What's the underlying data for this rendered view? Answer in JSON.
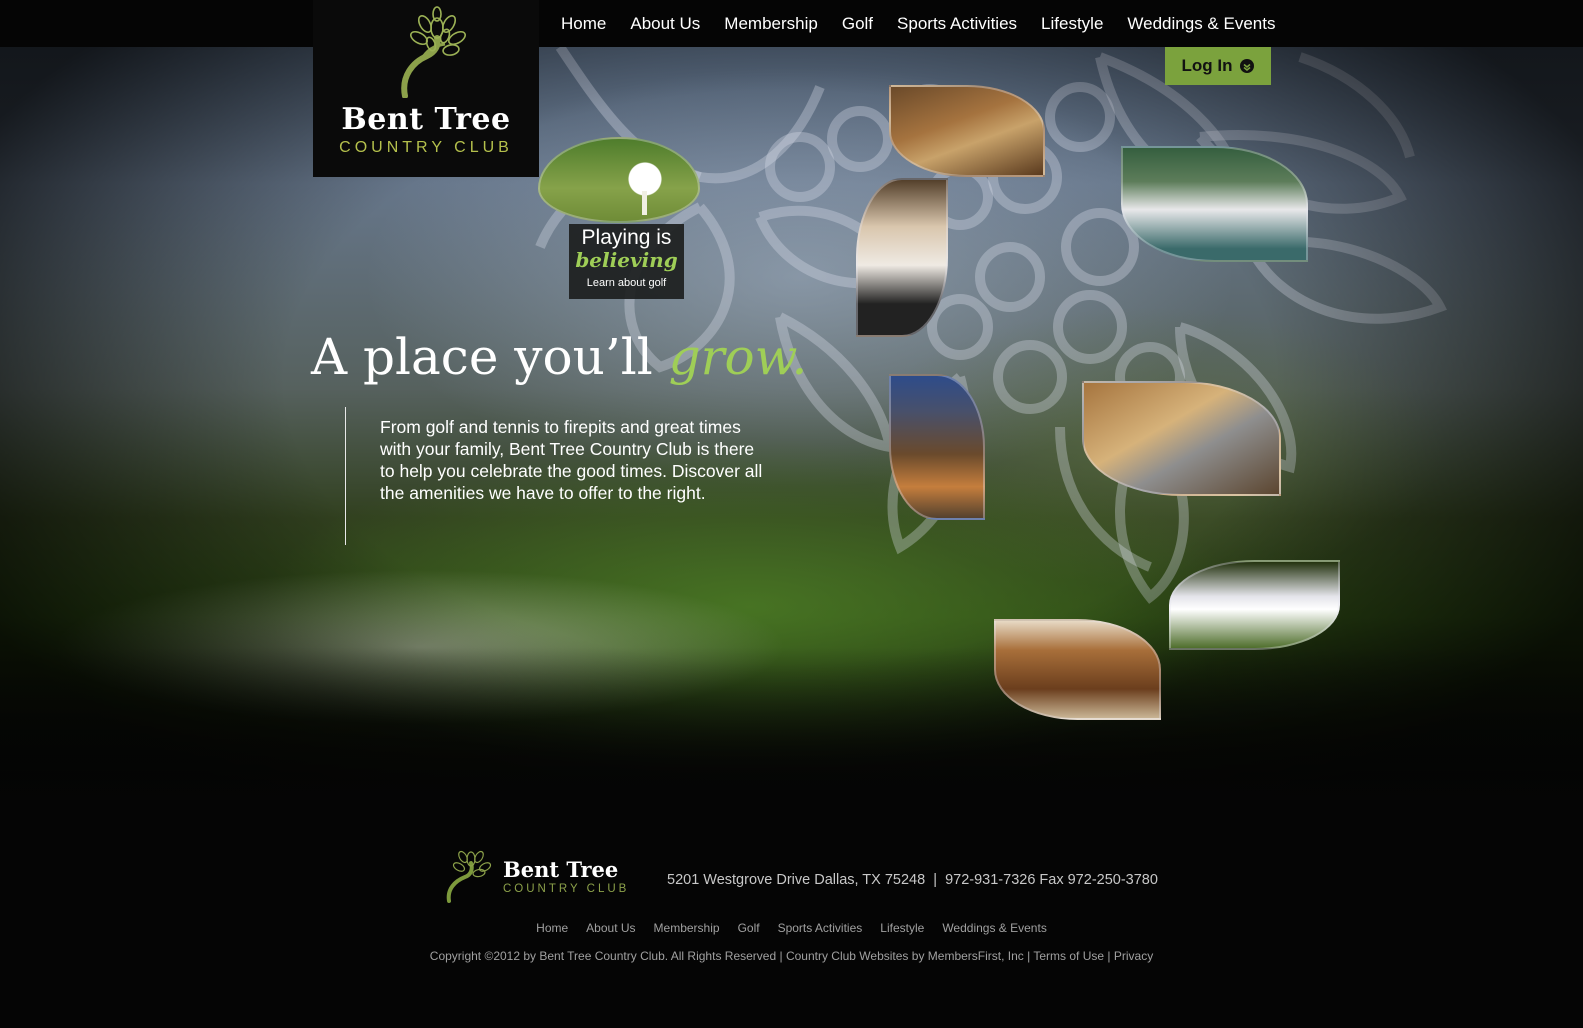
{
  "nav": {
    "items": [
      "Home",
      "About Us",
      "Membership",
      "Golf",
      "Sports Activities",
      "Lifestyle",
      "Weddings & Events"
    ]
  },
  "logo": {
    "name": "Bent Tree",
    "subtitle": "Country Club"
  },
  "login": {
    "label": "Log In",
    "icon": "chevron-down-icon"
  },
  "golf_card": {
    "line1": "Playing is",
    "line2": "believing",
    "link": "Learn about golf"
  },
  "hero": {
    "headline_main": "A place you’ll",
    "headline_accent": "grow.",
    "description": "From golf and tennis to firepits and great times with your family, Bent Tree Country Club is there to help you celebrate the good times. Discover all the amenities we have to offer to the right."
  },
  "gallery": {
    "images": [
      "golf-ball-on-tee",
      "dining-room",
      "celebrating-guest",
      "junior-tennis",
      "firepit-patio",
      "fitness-center",
      "golf-instruction",
      "clubhouse-doors"
    ]
  },
  "footer": {
    "logo_name": "Bent Tree",
    "logo_subtitle": "Country Club",
    "address": "5201 Westgrove Drive Dallas, TX 75248",
    "separator": "|",
    "phone": "972-931-7326 Fax 972-250-3780",
    "nav": [
      "Home",
      "About Us",
      "Membership",
      "Golf",
      "Sports Activities",
      "Lifestyle",
      "Weddings & Events"
    ],
    "copyright": "Copyright ©2012 by Bent Tree Country Club. All Rights Reserved",
    "credit": "Country Club Websites by MembersFirst, Inc",
    "terms": "Terms of Use",
    "privacy": "Privacy"
  },
  "colors": {
    "accent_green": "#9fce57",
    "button_green": "#7ba23d",
    "logo_gold": "#b4c04c"
  }
}
